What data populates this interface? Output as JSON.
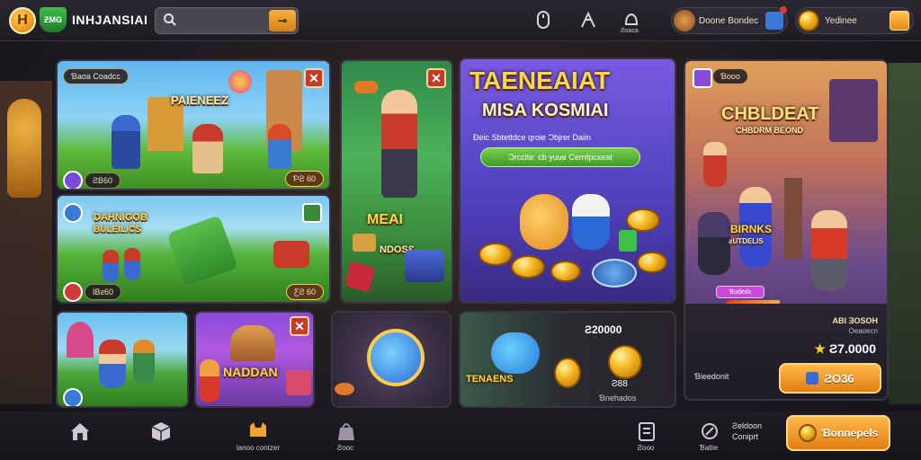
{
  "header": {
    "logo_letter": "H",
    "logo_shield_text": "ƵMG",
    "brand": "INHJANSIAI",
    "search_placeholder": "",
    "search_go": "⊸",
    "icons": [
      {
        "name": "mouse-icon",
        "label": ""
      },
      {
        "name": "flag-icon",
        "label": ""
      },
      {
        "name": "bell-icon",
        "label": "Ƨoaca"
      }
    ],
    "profile_label": "Doone Bondec",
    "wallet_label": "Yedinee"
  },
  "cards": {
    "c1": {
      "tag": "Ɓaoa Coadcc",
      "title": "PAIENEEZ",
      "badge": "ƧB60",
      "coins": "ƤƧ 60"
    },
    "c2": {
      "title1": "DAHNIGOB",
      "title2": "BULEILICS",
      "badge": "IBƨ60",
      "coins": "ƸƧ 60"
    },
    "c3": {
      "title1": "MEAI",
      "title2": "NDOSƐ"
    },
    "c4": {
      "title": "TAENEAIAT",
      "subtitle": "MISA KOSMIAI",
      "line": "Ɖeic Sbtettdce qroie Ɔbjrer Daiin",
      "button": "Ɔrccite: cb yuue Cernfpcxeat"
    },
    "c5": {
      "tag": "Ɓooo",
      "title": "CHBLDEAT",
      "subtitle": "CHBDRM BEOND",
      "banner": "BIRNKS",
      "sub2": "ƨUTDELIS",
      "pink": "Ɓodeds"
    },
    "c6": {},
    "c7": {
      "title": "NADDAN"
    },
    "c8": {},
    "c9": {
      "amount": "Ƨ20000",
      "label": "TENAENS",
      "coin_val": "Ƨ88",
      "sub": "Ɓnehados"
    },
    "c10": {
      "line1": "ABI ƎOSOH",
      "line2": "Oeaoecn",
      "price": "Ƨ7.0000",
      "footer": "Ɓieedonit",
      "button": "ƧO36"
    }
  },
  "nav": {
    "items": [
      {
        "name": "home-icon",
        "label": ""
      },
      {
        "name": "box-icon",
        "label": ""
      },
      {
        "name": "cat-icon",
        "label": "Ɩanoo contzer"
      },
      {
        "name": "bag-icon",
        "label": "Ƨooc"
      },
      {
        "name": "clipboard-icon",
        "label": "Ƨooo"
      },
      {
        "name": "sword-icon",
        "label": "Ɓaltie"
      }
    ],
    "side_text": "Ƨeldoon\nConiprt",
    "cta": "Ɓonnepels"
  },
  "colors": {
    "accent": "#f2a52e",
    "close": "#c63a2a",
    "green": "#3fbf4a"
  }
}
